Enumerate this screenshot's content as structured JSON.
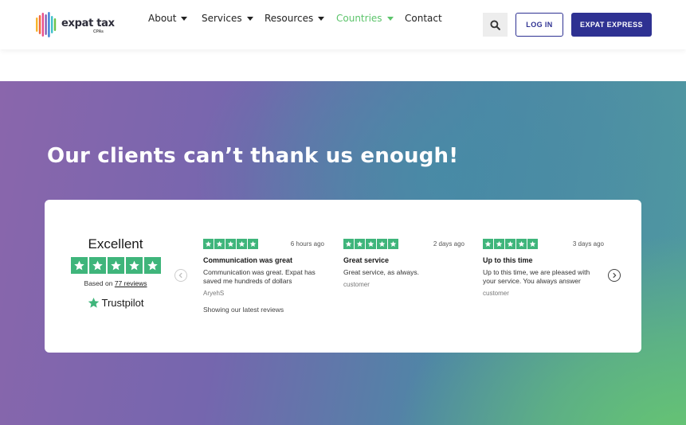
{
  "header": {
    "logo": {
      "name": "expat tax",
      "sub": "CPAs",
      "bar_colors": [
        "#f7b52b",
        "#ef6a3a",
        "#e84f8a",
        "#8b5fb6",
        "#3a7fd5",
        "#3fc0c9",
        "#6cc24a"
      ]
    },
    "nav": [
      {
        "label": "About",
        "has_caret": true,
        "active": false
      },
      {
        "label": "Services",
        "has_caret": true,
        "active": false
      },
      {
        "label": "Resources",
        "has_caret": true,
        "active": false
      },
      {
        "label": "Countries",
        "has_caret": true,
        "active": true
      },
      {
        "label": "Contact",
        "has_caret": false,
        "active": false
      }
    ],
    "search_icon": "search-icon",
    "login_label": "LOG IN",
    "express_label": "EXPAT EXPRESS"
  },
  "colors": {
    "brand": "#2e3192",
    "active_nav": "#5cc46b",
    "trustpilot_green": "#3fb57b"
  },
  "hero": {
    "title": "Our clients can’t thank us enough!"
  },
  "trustpilot": {
    "rating_label": "Excellent",
    "stars": 5,
    "based_on_prefix": "Based on",
    "reviews_link": "77 reviews",
    "brand": "Trustpilot",
    "reviews": [
      {
        "time": "6 hours ago",
        "title": "Communication was great",
        "body": "Communication was great. Expat has saved me hundreds of dollars",
        "author": "AryehS",
        "stars": 5
      },
      {
        "time": "2 days ago",
        "title": "Great service",
        "body": "Great service, as always.",
        "author": "customer",
        "stars": 5
      },
      {
        "time": "3 days ago",
        "title": "Up to this time",
        "body": "Up to this time, we are pleased with your service. You always answer",
        "author": "customer",
        "stars": 5
      }
    ],
    "showing_text": "Showing our latest reviews"
  }
}
